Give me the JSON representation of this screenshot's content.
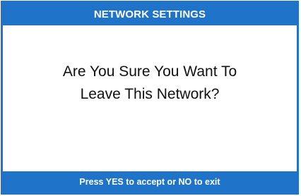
{
  "header": {
    "title": "NETWORK SETTINGS"
  },
  "dialog": {
    "message_line1": "Are You Sure You Want To",
    "message_line2": "Leave This Network?"
  },
  "footer": {
    "hint": "Press YES to accept or NO to exit"
  },
  "colors": {
    "accent": "#1f73c9",
    "background": "#ffffff",
    "text": "#111111"
  }
}
